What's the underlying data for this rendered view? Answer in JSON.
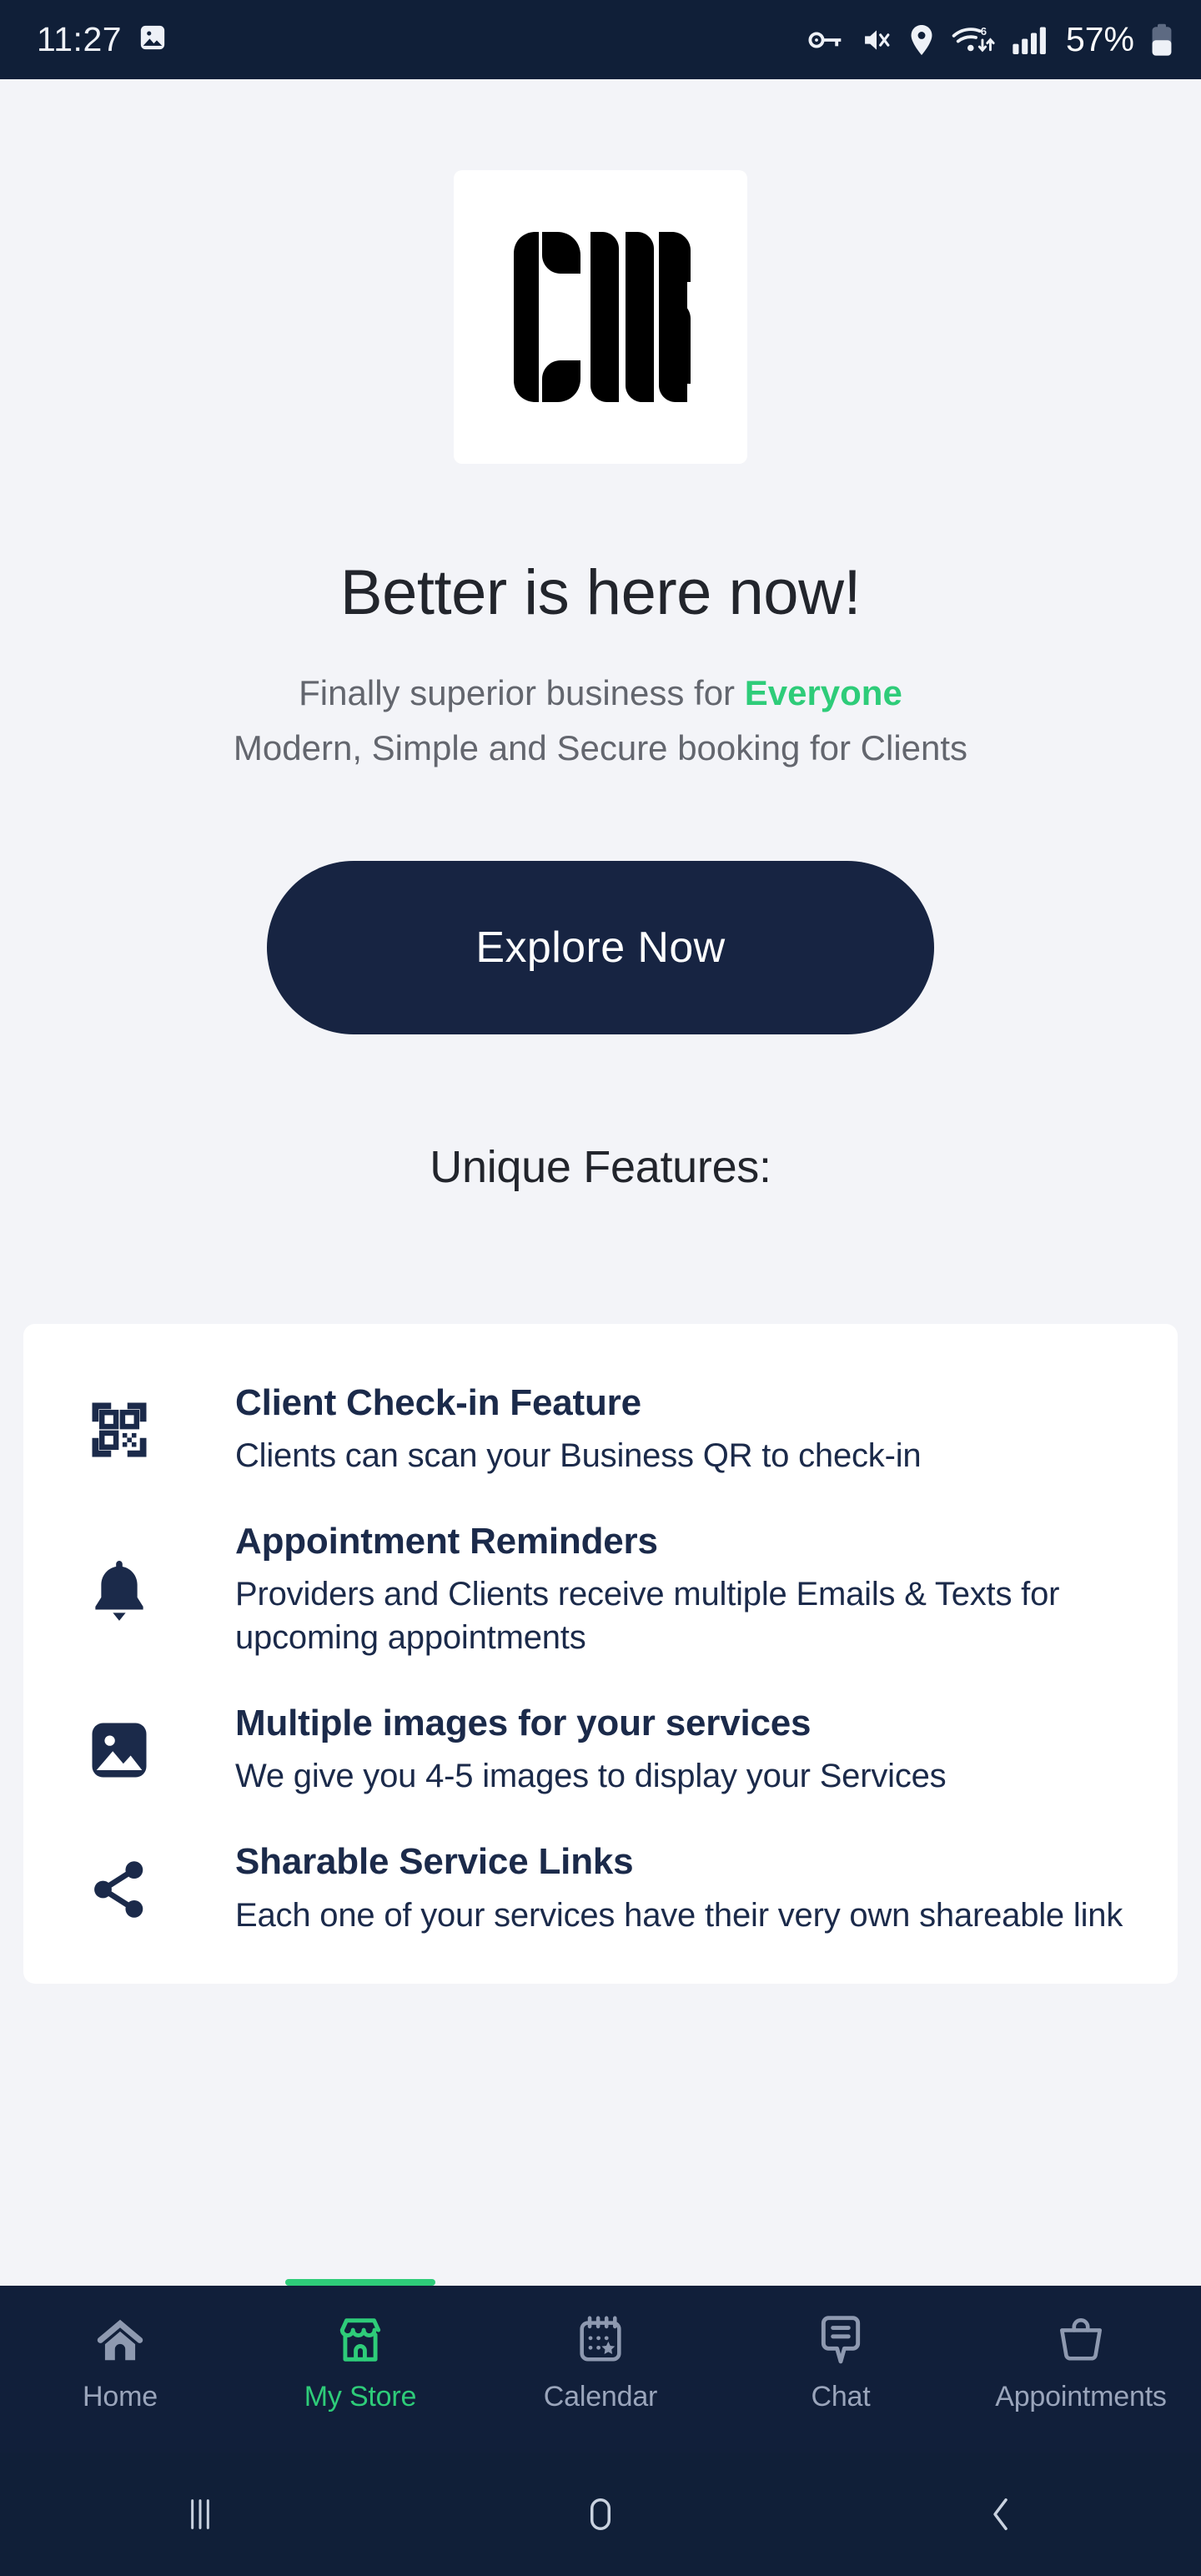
{
  "status_bar": {
    "time": "11:27",
    "battery_percent": "57%",
    "left_icons": [
      "image-icon"
    ],
    "right_icons": [
      "key-icon",
      "volume-mute-icon",
      "location-pin-icon",
      "wifi-6-icon",
      "cellular-signal-icon",
      "battery-icon"
    ]
  },
  "hero": {
    "logo_alt": "CUB",
    "headline": "Better is here now!",
    "subline_prefix": "Finally superior business for ",
    "subline_accent": "Everyone",
    "subline_second": "Modern, Simple and Secure booking for Clients",
    "cta_label": "Explore Now"
  },
  "features": {
    "section_title": "Unique Features:",
    "items": [
      {
        "icon": "qr-code-icon",
        "title": "Client Check-in Feature",
        "desc": "Clients can scan your Business QR to check-in"
      },
      {
        "icon": "bell-icon",
        "title": "Appointment Reminders",
        "desc": "Providers and Clients receive multiple Emails & Texts for upcoming appointments"
      },
      {
        "icon": "image-icon",
        "title": "Multiple images for your services",
        "desc": "We give you 4-5 images to display your Services"
      },
      {
        "icon": "share-icon",
        "title": "Sharable Service Links",
        "desc": "Each one of your services have their very own shareable link"
      }
    ]
  },
  "tab_bar": {
    "active_index": 1,
    "tabs": [
      {
        "label": "Home",
        "icon": "home-icon"
      },
      {
        "label": "My Store",
        "icon": "store-icon"
      },
      {
        "label": "Calendar",
        "icon": "calendar-star-icon"
      },
      {
        "label": "Chat",
        "icon": "chat-bubble-icon"
      },
      {
        "label": "Appointments",
        "icon": "basket-icon"
      }
    ]
  },
  "android_nav": {
    "recents_label": "Recent apps",
    "home_label": "Home",
    "back_label": "Back"
  },
  "colors": {
    "accent_green": "#2ecc79",
    "navy": "#172442",
    "page_bg": "#f3f4f8",
    "status_bg": "#101f38",
    "muted_text": "#63666e",
    "tab_inactive": "#9aa5bb"
  }
}
